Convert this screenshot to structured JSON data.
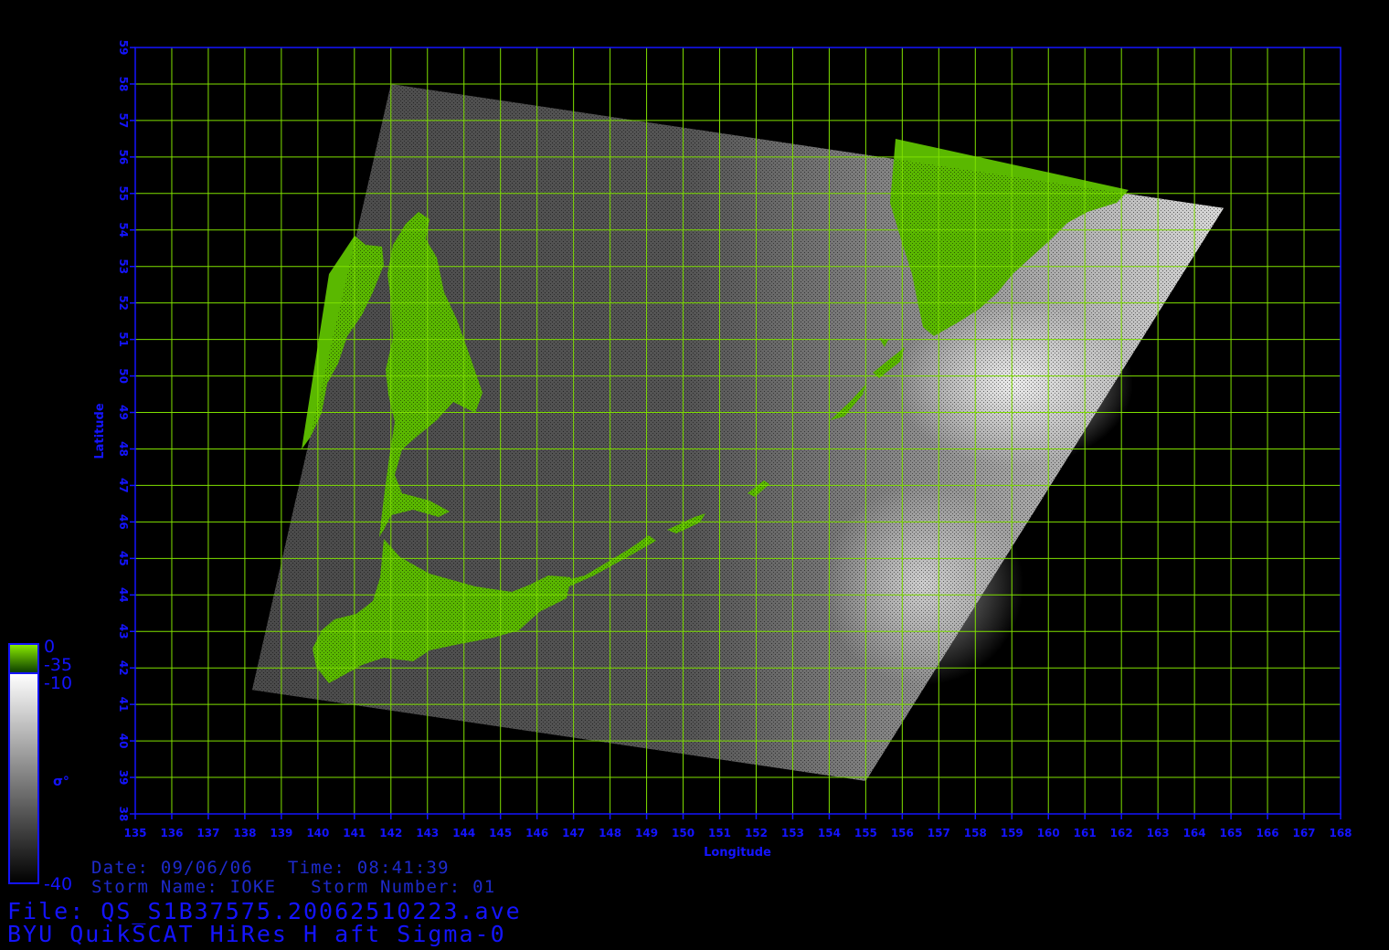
{
  "colors": {
    "axis": "#1414ff",
    "grid": "#7fe000",
    "land": "#5ab800",
    "ice": "#3a9a00"
  },
  "map": {
    "xlabel": "Longitude",
    "ylabel": "Latitude",
    "lon_range": [
      135,
      168
    ],
    "lat_range": [
      38,
      59
    ],
    "lon_ticks": [
      "135",
      "136",
      "137",
      "138",
      "139",
      "140",
      "141",
      "142",
      "143",
      "144",
      "145",
      "146",
      "147",
      "148",
      "149",
      "150",
      "151",
      "152",
      "153",
      "154",
      "155",
      "156",
      "157",
      "158",
      "159",
      "160",
      "161",
      "162",
      "163",
      "164",
      "165",
      "166",
      "167",
      "168"
    ],
    "lat_ticks": [
      "38",
      "39",
      "40",
      "41",
      "42",
      "43",
      "44",
      "45",
      "46",
      "47",
      "48",
      "49",
      "50",
      "51",
      "52",
      "53",
      "54",
      "55",
      "56",
      "57",
      "58",
      "59"
    ],
    "grid": true,
    "swath_corners_lonlat": [
      [
        142.0,
        58.0
      ],
      [
        164.8,
        54.6
      ],
      [
        155.0,
        38.9
      ],
      [
        138.2,
        41.4
      ]
    ]
  },
  "colorbar": {
    "land_scale": {
      "top": "0",
      "bottom": "-35"
    },
    "sigma_scale": {
      "top": "-10",
      "bottom": "-40"
    },
    "symbol": "σ°"
  },
  "info": {
    "date_time": "Date: 09/06/06   Time: 08:41:39",
    "storm": "Storm Name: IOKE   Storm Number: 01",
    "file": "File: QS_S1B37575.20062510223.ave",
    "product": "BYU QuikSCAT HiRes H aft Sigma-0"
  }
}
